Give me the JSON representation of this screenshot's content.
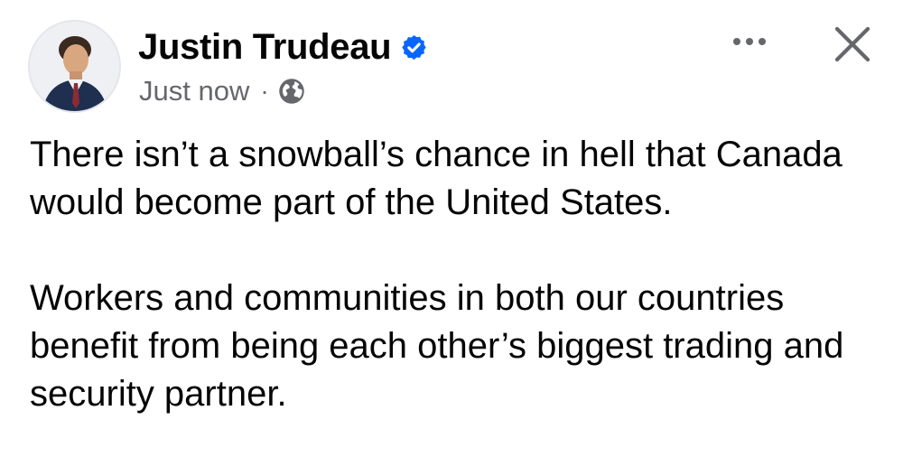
{
  "post": {
    "author": {
      "name": "Justin Trudeau",
      "verified_icon": "verified-badge-icon",
      "avatar_icon": "profile-photo"
    },
    "meta": {
      "timestamp": "Just now",
      "separator": "·",
      "privacy_icon": "globe-icon"
    },
    "actions": {
      "more_icon": "more-options-icon",
      "close_icon": "close-icon"
    },
    "paragraphs": [
      "There isn’t a snowball’s chance in hell that Canada would become part of the United States.",
      "Workers and communities in both our countries benefit from being each other’s biggest trading and security partner."
    ]
  },
  "colors": {
    "text_primary": "#050505",
    "text_secondary": "#65676b",
    "verified_blue": "#0866ff"
  }
}
